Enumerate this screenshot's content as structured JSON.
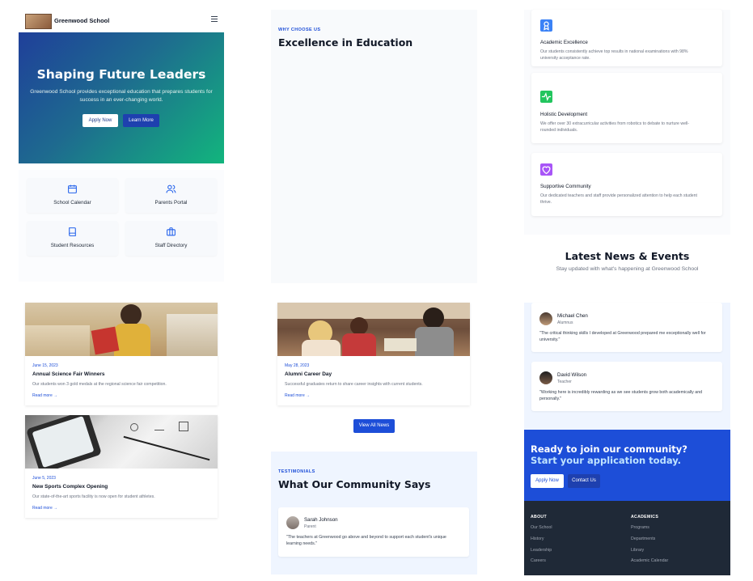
{
  "header": {
    "school_name": "Greenwood School"
  },
  "hero": {
    "title": "Shaping Future Leaders",
    "subtitle_line1": "Greenwood School provides exceptional education that prepares students for",
    "subtitle_line2": "success in an ever-changing world.",
    "apply_label": "Apply Now",
    "learn_label": "Learn More"
  },
  "quicklinks": [
    {
      "label": "School Calendar",
      "icon": "calendar-icon"
    },
    {
      "label": "Parents Portal",
      "icon": "users-icon"
    },
    {
      "label": "Student Resources",
      "icon": "book-icon"
    },
    {
      "label": "Staff Directory",
      "icon": "briefcase-icon"
    }
  ],
  "why": {
    "eyebrow": "WHY CHOOSE US",
    "title": "Excellence in Education"
  },
  "features": [
    {
      "title": "Academic Excellence",
      "desc1": "Our students consistently achieve top results in national examinations with 98%",
      "desc2": "university acceptance rate.",
      "icon": "award-icon",
      "color": "#3b82f6"
    },
    {
      "title": "Holistic Development",
      "desc1": "We offer over 30 extracurricular activities from robotics to debate to nurture well-",
      "desc2": "rounded individuals.",
      "icon": "activity-icon",
      "color": "#22c55e"
    },
    {
      "title": "Supportive Community",
      "desc1": "Our dedicated teachers and staff provide personalized attention to help each student",
      "desc2": "thrive.",
      "icon": "heart-icon",
      "color": "#a855f7"
    }
  ],
  "news_header": {
    "title": "Latest News & Events",
    "subtitle": "Stay updated with what's happening at Greenwood School"
  },
  "news": [
    {
      "date": "June 15, 2023",
      "title": "Annual Science Fair Winners",
      "desc": "Our students won 3 gold medals at the regional science fair competition.",
      "more": "Read more →"
    },
    {
      "date": "May 28, 2023",
      "title": "Alumni Career Day",
      "desc": "Successful graduates return to share career insights with current students.",
      "more": "Read more →"
    },
    {
      "date": "June 5, 2023",
      "title": "New Sports Complex Opening",
      "desc": "Our state-of-the-art sports facility is now open for student athletes.",
      "more": "Read more →"
    }
  ],
  "view_all_label": "View All News",
  "testimonials_header": {
    "eyebrow": "TESTIMONIALS",
    "title": "What Our Community Says"
  },
  "testimonials": [
    {
      "name": "Sarah Johnson",
      "role": "Parent",
      "quote1": "\"The teachers at Greenwood go above and beyond to support each student's unique",
      "quote2": "learning needs.\""
    },
    {
      "name": "Michael Chen",
      "role": "Alumnus",
      "quote1": "\"The critical thinking skills I developed at Greenwood prepared me exceptionally well for",
      "quote2": "university.\""
    },
    {
      "name": "David Wilson",
      "role": "Teacher",
      "quote1": "\"Working here is incredibly rewarding as we see students grow both academically and",
      "quote2": "personally.\""
    }
  ],
  "cta": {
    "line1": "Ready to join our community?",
    "line2": "Start your application today.",
    "apply_label": "Apply Now",
    "contact_label": "Contact Us"
  },
  "footer": {
    "about_head": "ABOUT",
    "about_links": [
      "Our School",
      "History",
      "Leadership",
      "Careers"
    ],
    "academics_head": "ACADEMICS",
    "academics_links": [
      "Programs",
      "Departments",
      "Library",
      "Academic Calendar"
    ]
  }
}
